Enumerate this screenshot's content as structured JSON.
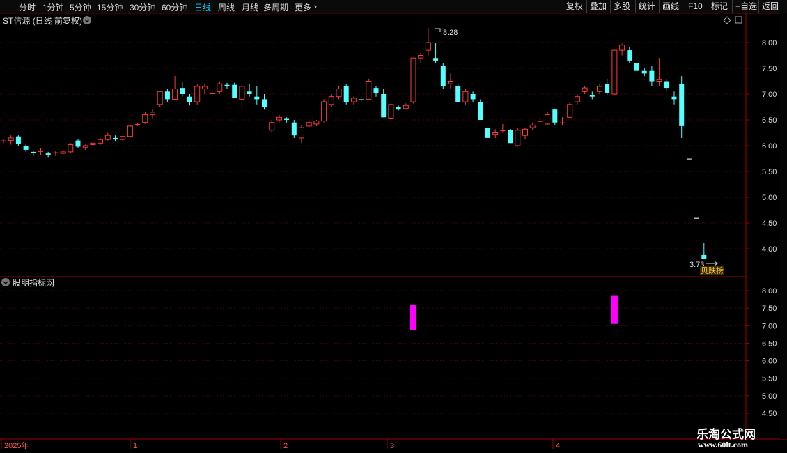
{
  "toolbar": {
    "tabs": [
      "分时",
      "1分钟",
      "5分钟",
      "15分钟",
      "30分钟",
      "60分钟",
      "日线",
      "周线",
      "月线",
      "多周期",
      "更多"
    ],
    "active_tab": "日线",
    "right_buttons": [
      "复权",
      "叠加",
      "多股",
      "统计",
      "画线",
      "F10",
      "标记",
      "+自选",
      "返回"
    ]
  },
  "main_chart": {
    "title": "ST信源 (日线 前复权)",
    "high_label": "8.28",
    "low_label": "3.73",
    "tag": "贝跌榜",
    "y_ticks": [
      "8.00",
      "7.50",
      "7.00",
      "6.50",
      "6.00",
      "5.50",
      "5.00",
      "4.50",
      "4.00"
    ]
  },
  "indicator": {
    "title": "股朋指标网",
    "y_ticks": [
      "8.00",
      "7.50",
      "7.00",
      "6.50",
      "6.00",
      "5.50",
      "5.00",
      "4.50"
    ]
  },
  "x_axis": {
    "labels": [
      "2025年",
      "1",
      "2",
      "3",
      "4"
    ]
  },
  "watermark": {
    "line1": "乐淘公式网",
    "line2": "www.60lt.com"
  },
  "colors": {
    "up": "#ff3a3a",
    "down": "#54ffff",
    "signal": "#ff00ff",
    "accent": "#00d7ff",
    "grid": "#5a0000"
  },
  "chart_data": {
    "type": "candlestick",
    "y_range": [
      3.6,
      8.4
    ],
    "ohlc": [
      [
        6.08,
        6.12,
        6.05,
        6.1
      ],
      [
        6.1,
        6.2,
        6.02,
        6.15
      ],
      [
        6.18,
        6.2,
        6.0,
        6.03
      ],
      [
        6.0,
        6.02,
        5.88,
        5.92
      ],
      [
        5.88,
        5.9,
        5.8,
        5.86
      ],
      [
        5.88,
        5.95,
        5.82,
        5.9
      ],
      [
        5.85,
        5.88,
        5.78,
        5.82
      ],
      [
        5.85,
        5.9,
        5.8,
        5.87
      ],
      [
        5.85,
        5.92,
        5.82,
        5.88
      ],
      [
        5.88,
        6.05,
        5.86,
        6.02
      ],
      [
        6.1,
        6.12,
        5.95,
        5.98
      ],
      [
        5.97,
        6.02,
        5.92,
        6.0
      ],
      [
        6.02,
        6.1,
        6.0,
        6.05
      ],
      [
        6.05,
        6.15,
        6.02,
        6.12
      ],
      [
        6.12,
        6.25,
        6.1,
        6.2
      ],
      [
        6.15,
        6.2,
        6.08,
        6.12
      ],
      [
        6.12,
        6.2,
        6.08,
        6.18
      ],
      [
        6.18,
        6.4,
        6.15,
        6.38
      ],
      [
        6.4,
        6.45,
        6.38,
        6.42
      ],
      [
        6.45,
        6.65,
        6.42,
        6.6
      ],
      [
        6.6,
        6.7,
        6.52,
        6.65
      ],
      [
        6.8,
        7.05,
        6.75,
        7.05
      ],
      [
        7.05,
        7.1,
        6.85,
        6.9
      ],
      [
        6.9,
        7.35,
        6.88,
        7.1
      ],
      [
        7.12,
        7.25,
        6.95,
        7.0
      ],
      [
        6.95,
        7.0,
        6.78,
        6.85
      ],
      [
        6.85,
        7.2,
        6.8,
        7.15
      ],
      [
        7.1,
        7.2,
        7.0,
        7.15
      ],
      [
        7.0,
        7.05,
        6.95,
        7.02
      ],
      [
        7.05,
        7.25,
        7.0,
        7.2
      ],
      [
        7.18,
        7.22,
        7.1,
        7.15
      ],
      [
        7.18,
        7.22,
        7.08,
        6.92
      ],
      [
        6.9,
        7.2,
        6.7,
        7.15
      ],
      [
        7.05,
        7.2,
        6.95,
        7.0
      ],
      [
        6.95,
        7.15,
        6.8,
        6.9
      ],
      [
        6.9,
        7.0,
        6.7,
        6.75
      ],
      [
        6.3,
        6.5,
        6.25,
        6.45
      ],
      [
        6.5,
        6.6,
        6.45,
        6.55
      ],
      [
        6.52,
        6.55,
        6.45,
        6.5
      ],
      [
        6.45,
        6.5,
        6.15,
        6.2
      ],
      [
        6.15,
        6.4,
        6.05,
        6.35
      ],
      [
        6.38,
        6.5,
        6.35,
        6.45
      ],
      [
        6.42,
        6.5,
        6.38,
        6.48
      ],
      [
        6.48,
        6.9,
        6.45,
        6.85
      ],
      [
        6.8,
        7.0,
        6.75,
        6.95
      ],
      [
        6.95,
        7.15,
        6.9,
        7.1
      ],
      [
        7.15,
        7.2,
        6.8,
        6.85
      ],
      [
        6.85,
        6.95,
        6.8,
        6.92
      ],
      [
        6.9,
        6.95,
        6.85,
        6.88
      ],
      [
        6.9,
        7.3,
        6.88,
        7.25
      ],
      [
        7.12,
        7.15,
        6.95,
        7.02
      ],
      [
        7.0,
        7.1,
        6.55,
        6.55
      ],
      [
        6.52,
        6.85,
        6.5,
        6.8
      ],
      [
        6.75,
        6.78,
        6.68,
        6.7
      ],
      [
        6.72,
        6.82,
        6.7,
        6.78
      ],
      [
        6.85,
        7.6,
        6.82,
        7.7
      ],
      [
        7.7,
        7.8,
        7.6,
        7.75
      ],
      [
        7.85,
        8.28,
        7.75,
        8.0
      ],
      [
        7.7,
        8.0,
        7.6,
        7.65
      ],
      [
        7.55,
        7.6,
        7.1,
        7.15
      ],
      [
        7.2,
        7.4,
        7.1,
        7.25
      ],
      [
        7.15,
        7.2,
        6.85,
        6.85
      ],
      [
        6.85,
        7.1,
        6.8,
        7.05
      ],
      [
        7.0,
        7.05,
        6.85,
        6.9
      ],
      [
        6.85,
        6.9,
        6.5,
        6.5
      ],
      [
        6.35,
        6.45,
        6.05,
        6.15
      ],
      [
        6.22,
        6.32,
        6.15,
        6.25
      ],
      [
        6.3,
        6.42,
        6.25,
        6.3
      ],
      [
        6.3,
        6.32,
        6.05,
        6.05
      ],
      [
        6.0,
        6.35,
        5.98,
        6.3
      ],
      [
        6.2,
        6.35,
        6.12,
        6.32
      ],
      [
        6.35,
        6.45,
        6.3,
        6.4
      ],
      [
        6.48,
        6.55,
        6.42,
        6.48
      ],
      [
        6.42,
        6.65,
        6.4,
        6.6
      ],
      [
        6.7,
        6.72,
        6.4,
        6.45
      ],
      [
        6.45,
        6.55,
        6.4,
        6.45
      ],
      [
        6.55,
        6.85,
        6.52,
        6.8
      ],
      [
        6.85,
        7.0,
        6.8,
        6.95
      ],
      [
        7.05,
        7.15,
        7.0,
        7.12
      ],
      [
        6.98,
        7.05,
        6.9,
        6.95
      ],
      [
        7.05,
        7.2,
        7.0,
        7.15
      ],
      [
        7.2,
        7.3,
        6.98,
        7.02
      ],
      [
        7.0,
        7.85,
        6.98,
        7.85
      ],
      [
        7.85,
        7.98,
        7.75,
        7.95
      ],
      [
        7.85,
        7.92,
        7.6,
        7.65
      ],
      [
        7.6,
        7.65,
        7.4,
        7.45
      ],
      [
        7.45,
        7.5,
        7.35,
        7.4
      ],
      [
        7.45,
        7.55,
        7.15,
        7.25
      ],
      [
        7.25,
        7.7,
        7.15,
        7.28
      ],
      [
        7.25,
        7.3,
        7.05,
        7.12
      ],
      [
        6.95,
        7.05,
        6.8,
        6.9
      ],
      [
        7.2,
        7.35,
        6.15,
        6.38
      ],
      [
        5.75,
        5.75,
        5.75,
        5.75
      ],
      [
        4.6,
        4.6,
        4.6,
        4.6
      ],
      [
        3.88,
        4.12,
        3.82,
        3.8
      ]
    ],
    "signals": [
      {
        "index": 55,
        "from": 6.88,
        "to": 7.6
      },
      {
        "index": 82,
        "from": 7.05,
        "to": 7.85
      }
    ]
  }
}
